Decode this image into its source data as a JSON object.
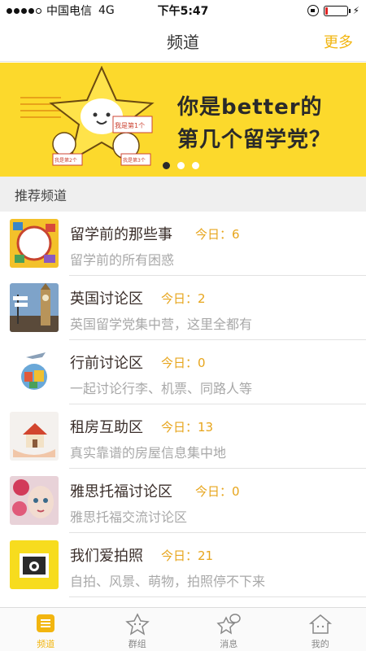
{
  "status_bar": {
    "carrier": "中国电信",
    "network": "4G",
    "time": "下午5:47",
    "battery_level": 0.15
  },
  "nav": {
    "title": "频道",
    "more": "更多"
  },
  "banner": {
    "line1": "你是better的",
    "line2": "第几个留学党？",
    "sign1": "我是第1个",
    "sign2": "我是第2个",
    "sign3": "我是第3个",
    "slide_count": 3,
    "active_slide": 1
  },
  "section": {
    "title": "推荐频道"
  },
  "channels": [
    {
      "title": "留学前的那些事",
      "count": "今日：6",
      "subtitle": "留学前的所有困惑",
      "icon": "travel-stamps-icon"
    },
    {
      "title": "英国讨论区",
      "count": "今日：2",
      "subtitle": "英国留学党集中营，这里全都有",
      "icon": "big-ben-icon"
    },
    {
      "title": "行前讨论区",
      "count": "今日：0",
      "subtitle": "一起讨论行李、机票、同路人等",
      "icon": "luggage-plane-icon"
    },
    {
      "title": "租房互助区",
      "count": "今日：13",
      "subtitle": "真实靠谱的房屋信息集中地",
      "icon": "house-hands-icon"
    },
    {
      "title": "雅思托福讨论区",
      "count": "今日：0",
      "subtitle": "雅思托福交流讨论区",
      "icon": "girl-roses-icon"
    },
    {
      "title": "我们爱拍照",
      "count": "今日：21",
      "subtitle": "自拍、风景、萌物，拍照停不下来",
      "icon": "camera-icon"
    }
  ],
  "tabs": [
    {
      "label": "频道",
      "icon": "channel-icon",
      "active": true
    },
    {
      "label": "群组",
      "icon": "group-star-icon",
      "active": false
    },
    {
      "label": "消息",
      "icon": "message-star-icon",
      "active": false
    },
    {
      "label": "我的",
      "icon": "profile-house-icon",
      "active": false
    }
  ],
  "colors": {
    "accent": "#f2b50f",
    "banner_bg": "#fcd92c",
    "count": "#e7a51c"
  }
}
